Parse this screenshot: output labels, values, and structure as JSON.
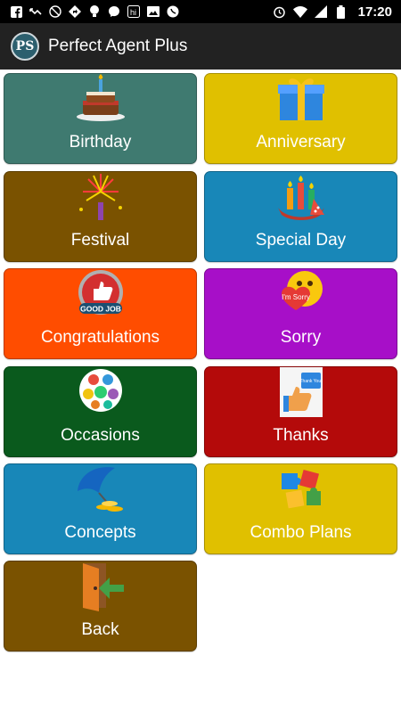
{
  "status_bar": {
    "time": "17:20",
    "left_icons": [
      "facebook-icon",
      "missed-call-icon",
      "no-signal-icon",
      "location-icon",
      "bulb-icon",
      "messenger-icon",
      "hike-icon",
      "image-icon",
      "whatsapp-icon"
    ],
    "right_icons": [
      "alarm-icon",
      "wifi-icon",
      "signal-icon",
      "battery-icon"
    ]
  },
  "app_bar": {
    "title": "Perfect Agent Plus",
    "logo_text": "PS"
  },
  "colors": {
    "birthday": "#3f7a70",
    "anniversary": "#e0c000",
    "festival": "#7a5200",
    "special_day": "#1887b8",
    "congratulations": "#ff4d00",
    "sorry": "#a70fc8",
    "occasions": "#0a5a1d",
    "thanks": "#b40a0a",
    "concepts": "#1887b8",
    "combo_plans": "#e0c000",
    "back": "#7a5200"
  },
  "tiles": [
    {
      "label": "Birthday",
      "icon": "birthday-cake-icon"
    },
    {
      "label": "Anniversary",
      "icon": "gift-box-icon"
    },
    {
      "label": "Festival",
      "icon": "fireworks-icon"
    },
    {
      "label": "Special Day",
      "icon": "candles-icon"
    },
    {
      "label": "Congratulations",
      "icon": "good-job-badge-icon",
      "badge_text": "GOOD JOB"
    },
    {
      "label": "Sorry",
      "icon": "sorry-emoji-icon",
      "badge_text": "I'm Sorry"
    },
    {
      "label": "Occasions",
      "icon": "occasions-collage-icon"
    },
    {
      "label": "Thanks",
      "icon": "thanks-thumbs-up-icon",
      "badge_text": "Thank You!"
    },
    {
      "label": "Concepts",
      "icon": "umbrella-coins-icon"
    },
    {
      "label": "Combo Plans",
      "icon": "puzzle-icon"
    },
    {
      "label": "Back",
      "icon": "exit-door-icon"
    }
  ]
}
